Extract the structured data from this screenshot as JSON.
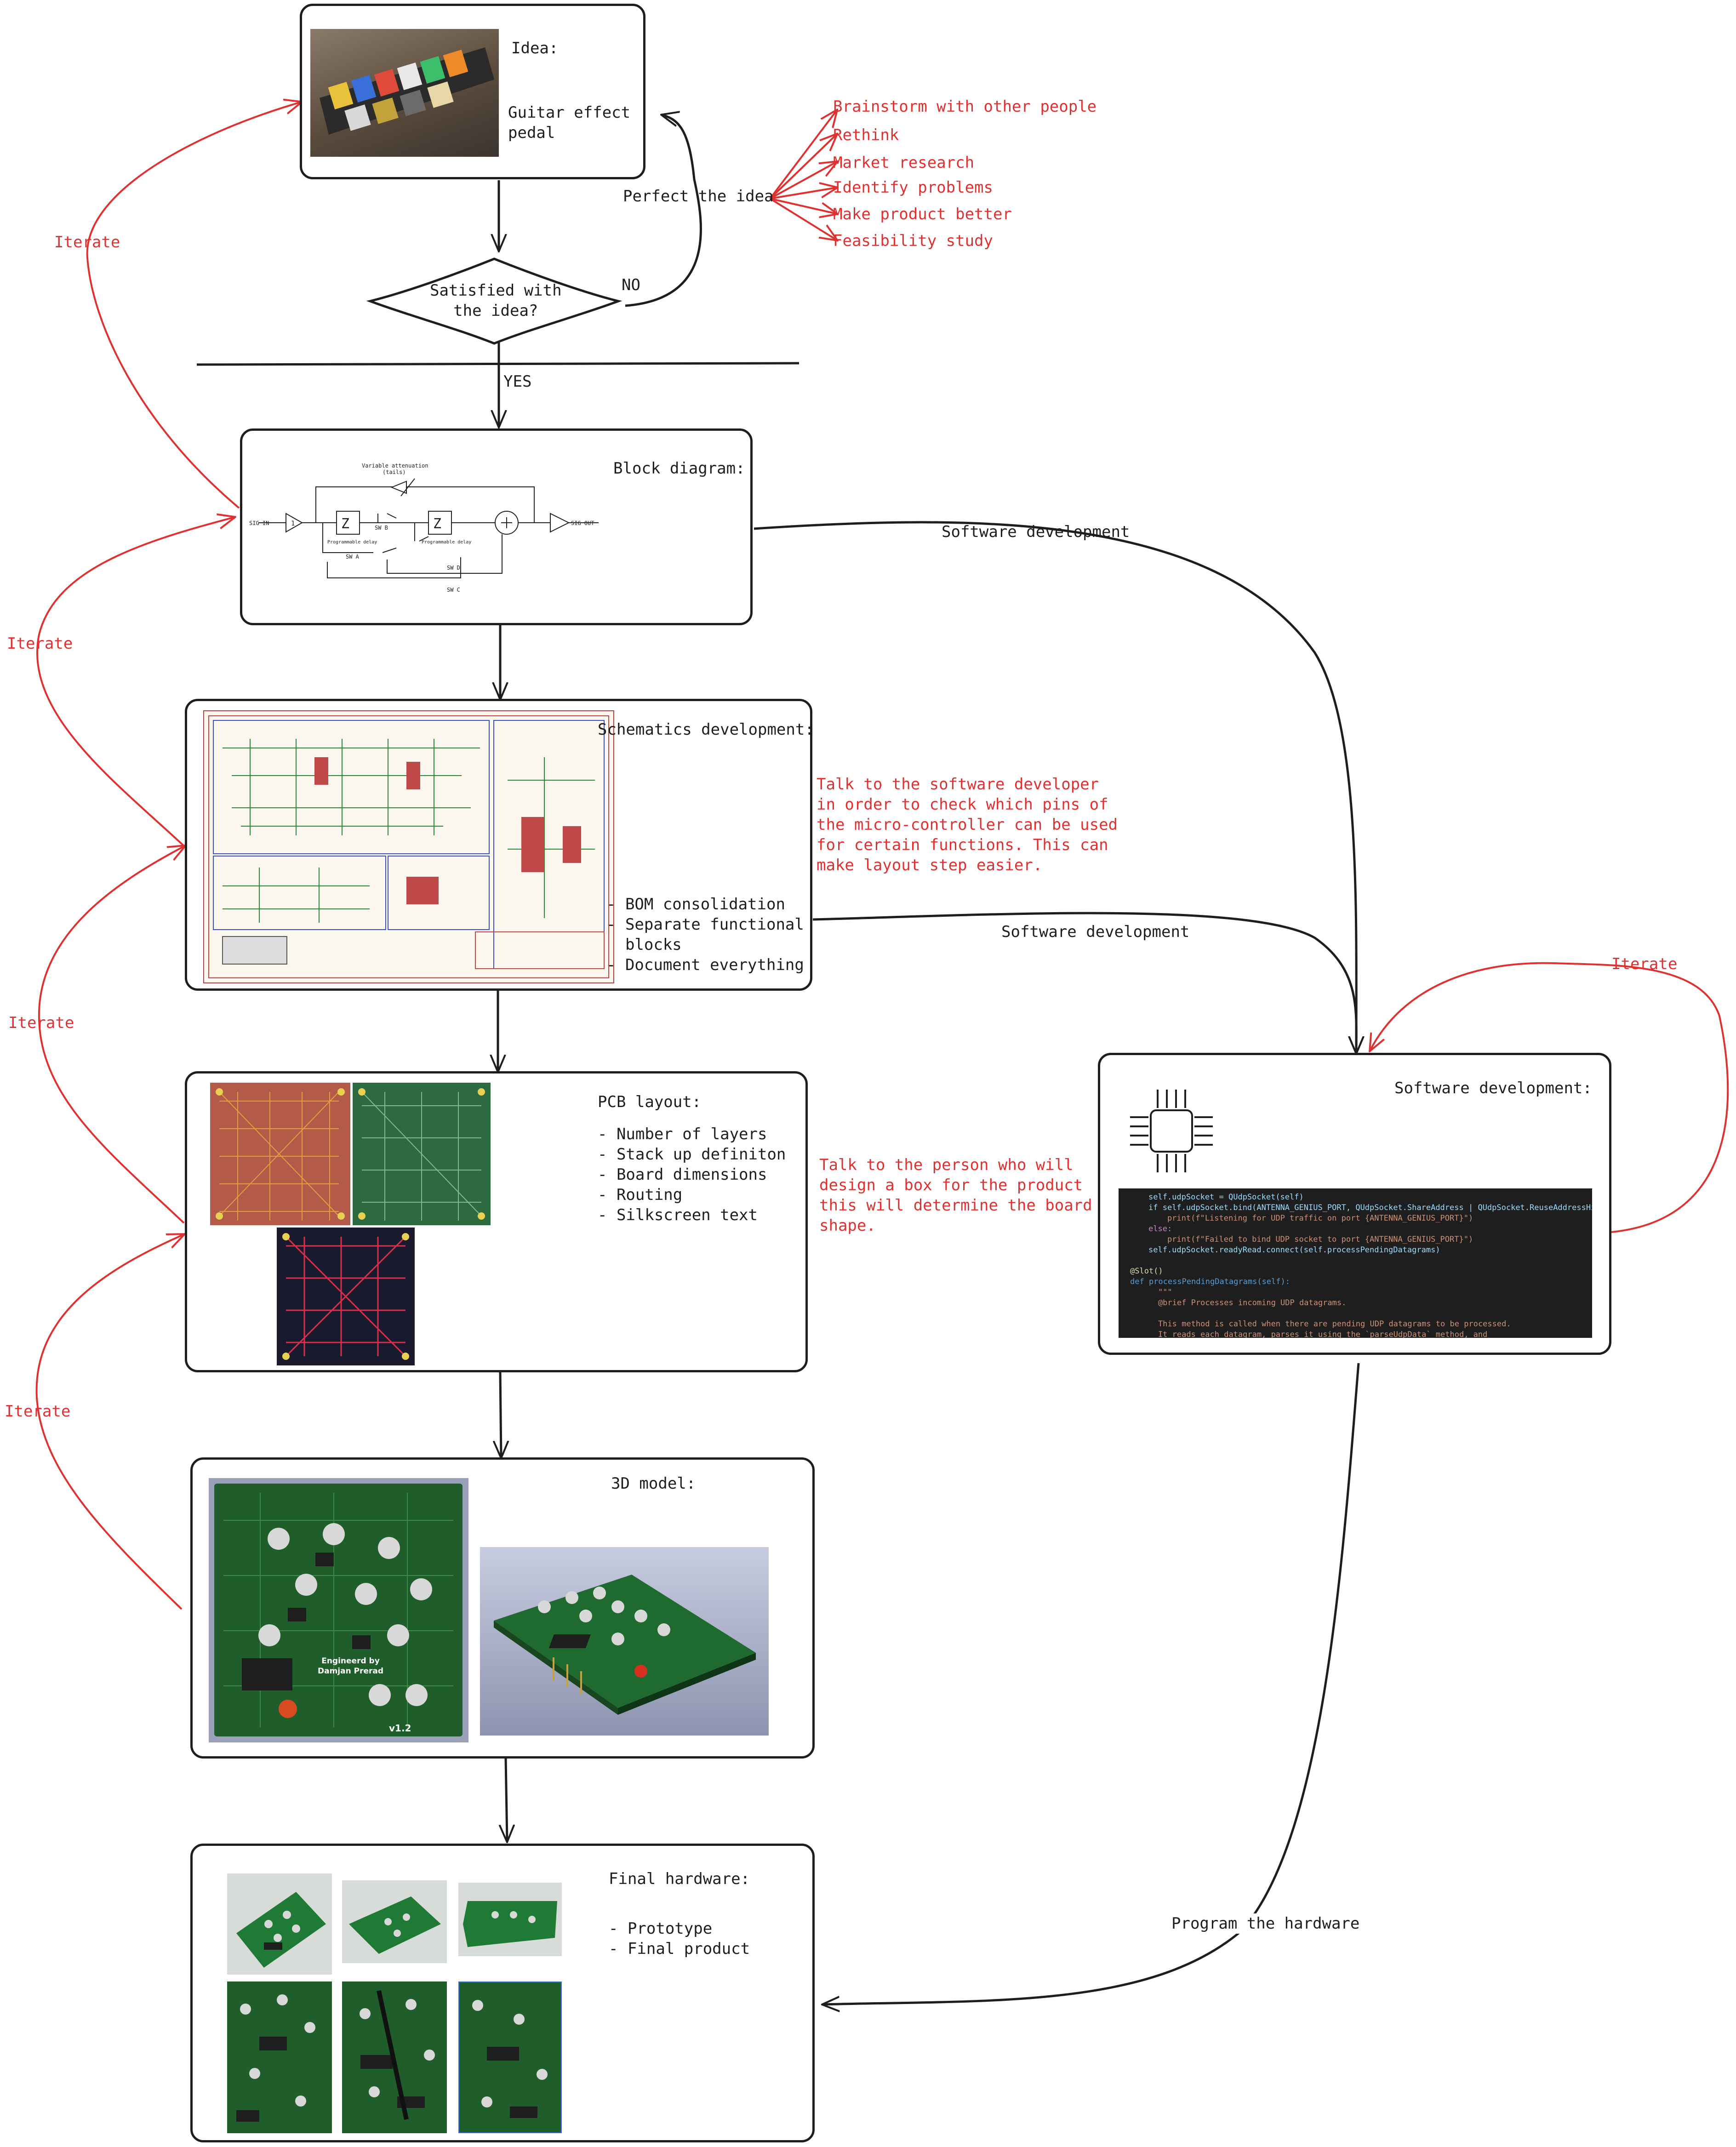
{
  "idea": {
    "heading": "Idea:",
    "text": "Guitar effect\npedal"
  },
  "perfect_idea": {
    "label": "Perfect the idea",
    "items": [
      "Brainstorm with other people",
      "Rethink",
      "Market research",
      "Identify problems",
      "Make product better",
      "Feasibility study"
    ]
  },
  "decision": {
    "text": "Satisfied with\nthe idea?",
    "no": "NO",
    "yes": "YES"
  },
  "iterate_label": "Iterate",
  "block_diagram": {
    "heading": "Block diagram:",
    "labels": {
      "variable_attenuation": "Variable attenuation\n(tails)",
      "sig_in": "SIG IN",
      "sig_out": "SIG OUT",
      "z": "Z",
      "one": "1",
      "sw_a": "SW A",
      "sw_b": "SW B",
      "sw_c": "SW C",
      "sw_d": "SW D",
      "prog_delay": "Programmable delay"
    }
  },
  "schematics": {
    "heading": "Schematics development:",
    "items": [
      "- BOM consolidation",
      "- Separate functional\n  blocks",
      "- Document everything"
    ],
    "note": "Talk to the software developer\nin order to check which pins of\nthe micro-controller can be used\nfor certain functions. This can\nmake layout step easier."
  },
  "pcb": {
    "heading": "PCB layout:",
    "items": [
      "- Number of layers",
      "- Stack up definiton",
      "- Board dimensions",
      "- Routing",
      "- Silkscreen text"
    ],
    "note": "Talk to the person who will\ndesign a box for the product\nthis will determine the board\nshape."
  },
  "model3d": {
    "heading": "3D model:",
    "board_text": "Engineerd by\nDamjan Prerad",
    "version": "v1.2"
  },
  "final": {
    "heading": "Final hardware:",
    "items": [
      "- Prototype",
      "- Final product"
    ]
  },
  "software": {
    "heading": "Software development:",
    "code": [
      "self.udpSocket = QUdpSocket(self)",
      "if self.udpSocket.bind(ANTENNA_GENIUS_PORT, QUdpSocket.ShareAddress | QUdpSocket.ReuseAddressHint):",
      "    print(f\"Listening for UDP traffic on port {ANTENNA_GENIUS_PORT}\")",
      "else:",
      "    print(f\"Failed to bind UDP socket to port {ANTENNA_GENIUS_PORT}\")",
      "self.udpSocket.readyRead.connect(self.processPendingDatagrams)",
      "",
      "@Slot()",
      "def processPendingDatagrams(self):",
      "    \"\"\"",
      "    @brief Processes incoming UDP datagrams.",
      "",
      "    This method is called when there are pending UDP datagrams to be processed.",
      "    It reads each datagram, parses it using the `parseUdpData` method, and"
    ]
  },
  "edge_labels": {
    "software_dev_1": "Software development",
    "software_dev_2": "Software development",
    "program_hw": "Program the hardware",
    "iterate_sw": "Iterate"
  },
  "colors": {
    "stroke": "#1e1e1e",
    "accent": "#e03131",
    "code_bg": "#1e1e1e"
  }
}
